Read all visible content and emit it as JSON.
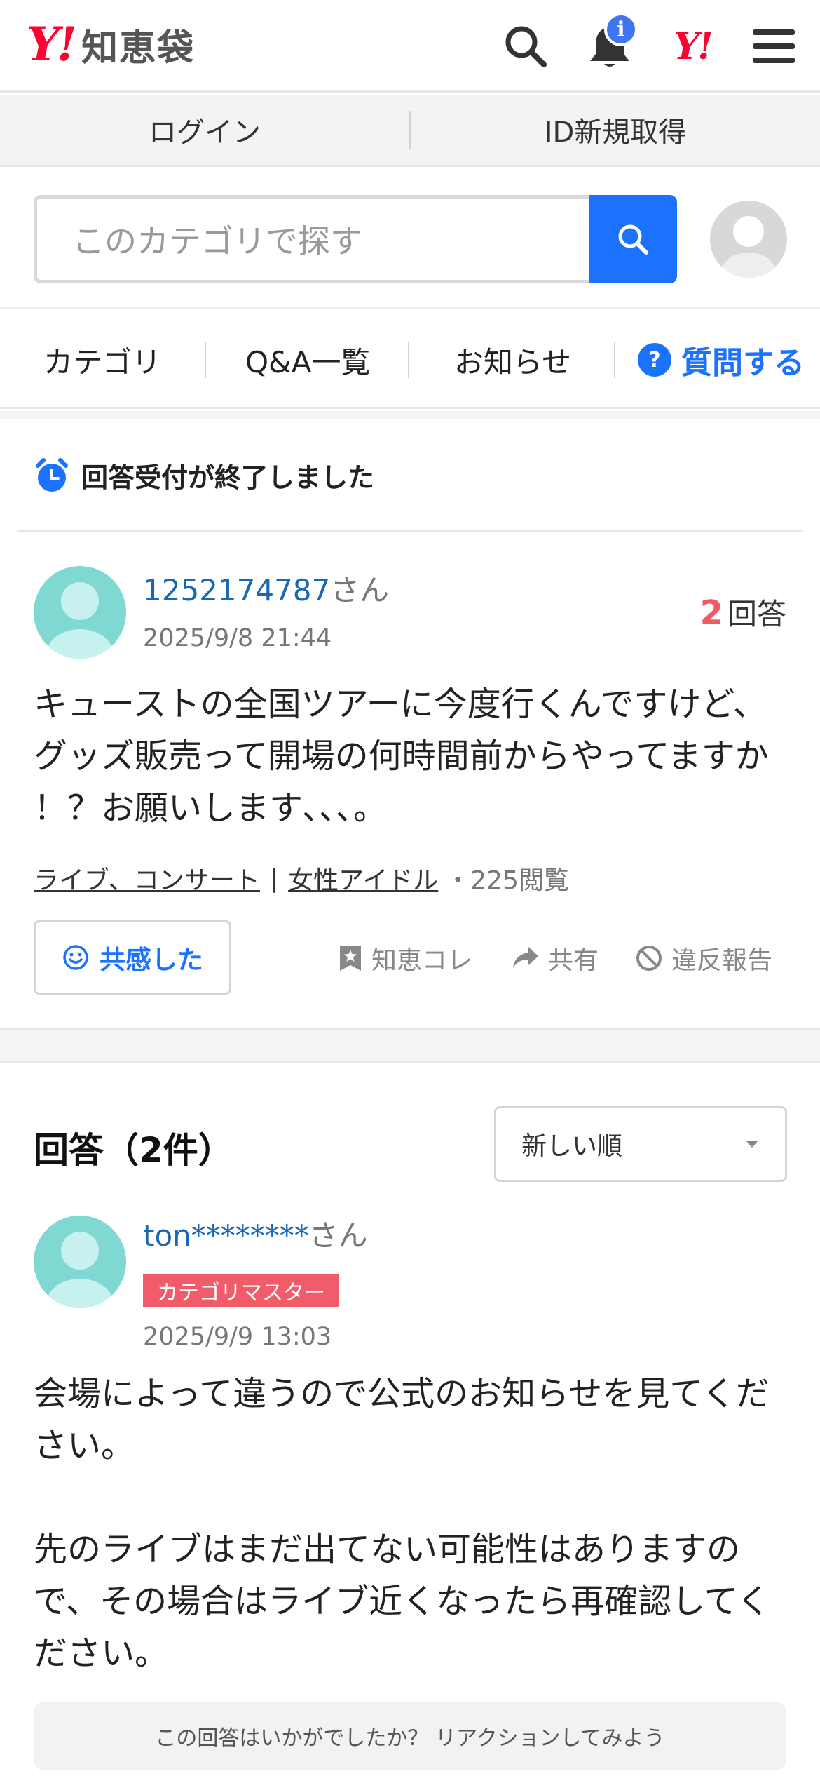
{
  "header": {
    "logo_mark": "Y!",
    "logo_text": "知恵袋",
    "bell_badge": "i",
    "yj_mark": "Y!"
  },
  "loginbar": {
    "login": "ログイン",
    "signup": "ID新規取得"
  },
  "search": {
    "placeholder": "このカテゴリで探す"
  },
  "nav": {
    "category": "カテゴリ",
    "qa_list": "Q&A一覧",
    "news": "お知らせ",
    "ask": "質問する",
    "ask_icon": "?"
  },
  "question": {
    "closed_notice": "回答受付が終了しました",
    "user": "1252174787",
    "user_suffix": "さん",
    "date": "2025/9/8 21:44",
    "answer_count": "2",
    "answer_label": "回答",
    "body_lines": [
      "キューストの全国ツアーに今度行くんですけど、",
      "グッズ販売って開場の何時間前からやってますか",
      "！？お願いします､､､。"
    ],
    "tag1": "ライブ、コンサート",
    "tag_sep": "|",
    "tag2": "女性アイドル",
    "views": "・225閲覧",
    "empathy": "共感した",
    "save": "知恵コレ",
    "share": "共有",
    "report": "違反報告"
  },
  "answers": {
    "heading": "回答（2件）",
    "sort_selected": "新しい順",
    "first": {
      "user": "ton********",
      "user_suffix": "さん",
      "badge": "カテゴリマスター",
      "date": "2025/9/9 13:03",
      "body_lines": [
        "会場によって違うので公式のお知らせを見てくだ",
        "さい。",
        "",
        "先のライブはまだ出てない可能性はありますの",
        "で、その場合はライブ近くなったら再確認してく",
        "ださい。"
      ]
    },
    "reaction_prompt": "この回答はいかがでしたか？ リアクションしてみよう"
  },
  "colors": {
    "brand_red": "#ff0033",
    "accent_blue": "#1b72ff",
    "username_blue": "#1768b6",
    "badge_red": "#f25b6a",
    "count_red": "#f05a64"
  }
}
